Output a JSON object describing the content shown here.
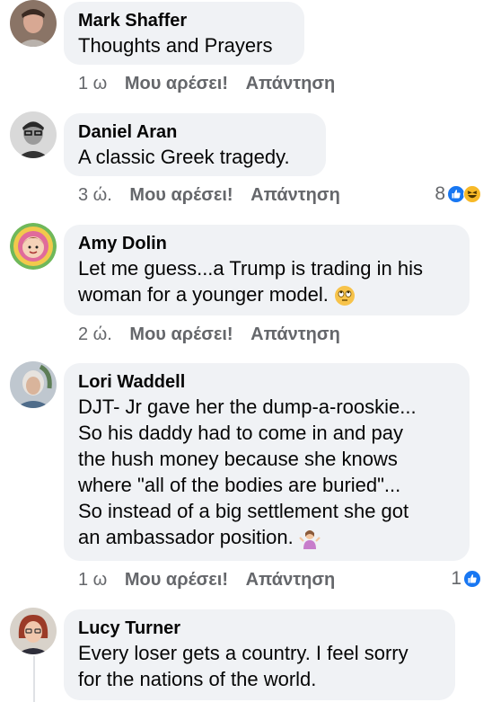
{
  "comments": [
    {
      "author": "Mark Shaffer",
      "lines": [
        "Thoughts and Prayers"
      ],
      "time": "1 ω",
      "like": "Μου αρέσει!",
      "reply": "Απάντηση",
      "reaction_count": ""
    },
    {
      "author": "Daniel Aran",
      "lines": [
        "A classic Greek tragedy."
      ],
      "time": "3 ώ.",
      "like": "Μου αρέσει!",
      "reply": "Απάντηση",
      "reaction_count": "8",
      "reaction_icons": [
        "like-icon",
        "haha-icon"
      ]
    },
    {
      "author": "Amy Dolin",
      "lines": [
        "Let me guess...a Trump is trading in his",
        "woman for a younger model."
      ],
      "time": "2 ώ.",
      "like": "Μου αρέσει!",
      "reply": "Απάντηση",
      "reaction_count": ""
    },
    {
      "author": "Lori Waddell",
      "lines": [
        "DJT- Jr gave her the dump-a-rooskie...",
        "So his daddy had to come in and pay",
        "the hush money because she knows",
        "where \"all of the bodies are buried\"...",
        "So instead of a big settlement she got",
        "an ambassador position."
      ],
      "time": "1 ω",
      "like": "Μου αρέσει!",
      "reply": "Απάντηση",
      "reaction_count": "1",
      "reaction_icons": [
        "like-icon"
      ]
    },
    {
      "author": "Lucy Turner",
      "lines": [
        "Every loser gets a country. I feel sorry",
        "for the nations of the world."
      ],
      "time": "",
      "like": "",
      "reply": "",
      "reaction_count": ""
    }
  ],
  "colors": {
    "bubble": "#f0f2f5",
    "meta_text": "#65676b",
    "like_blue": "#1877f2",
    "haha_yellow": "#f7b928"
  }
}
